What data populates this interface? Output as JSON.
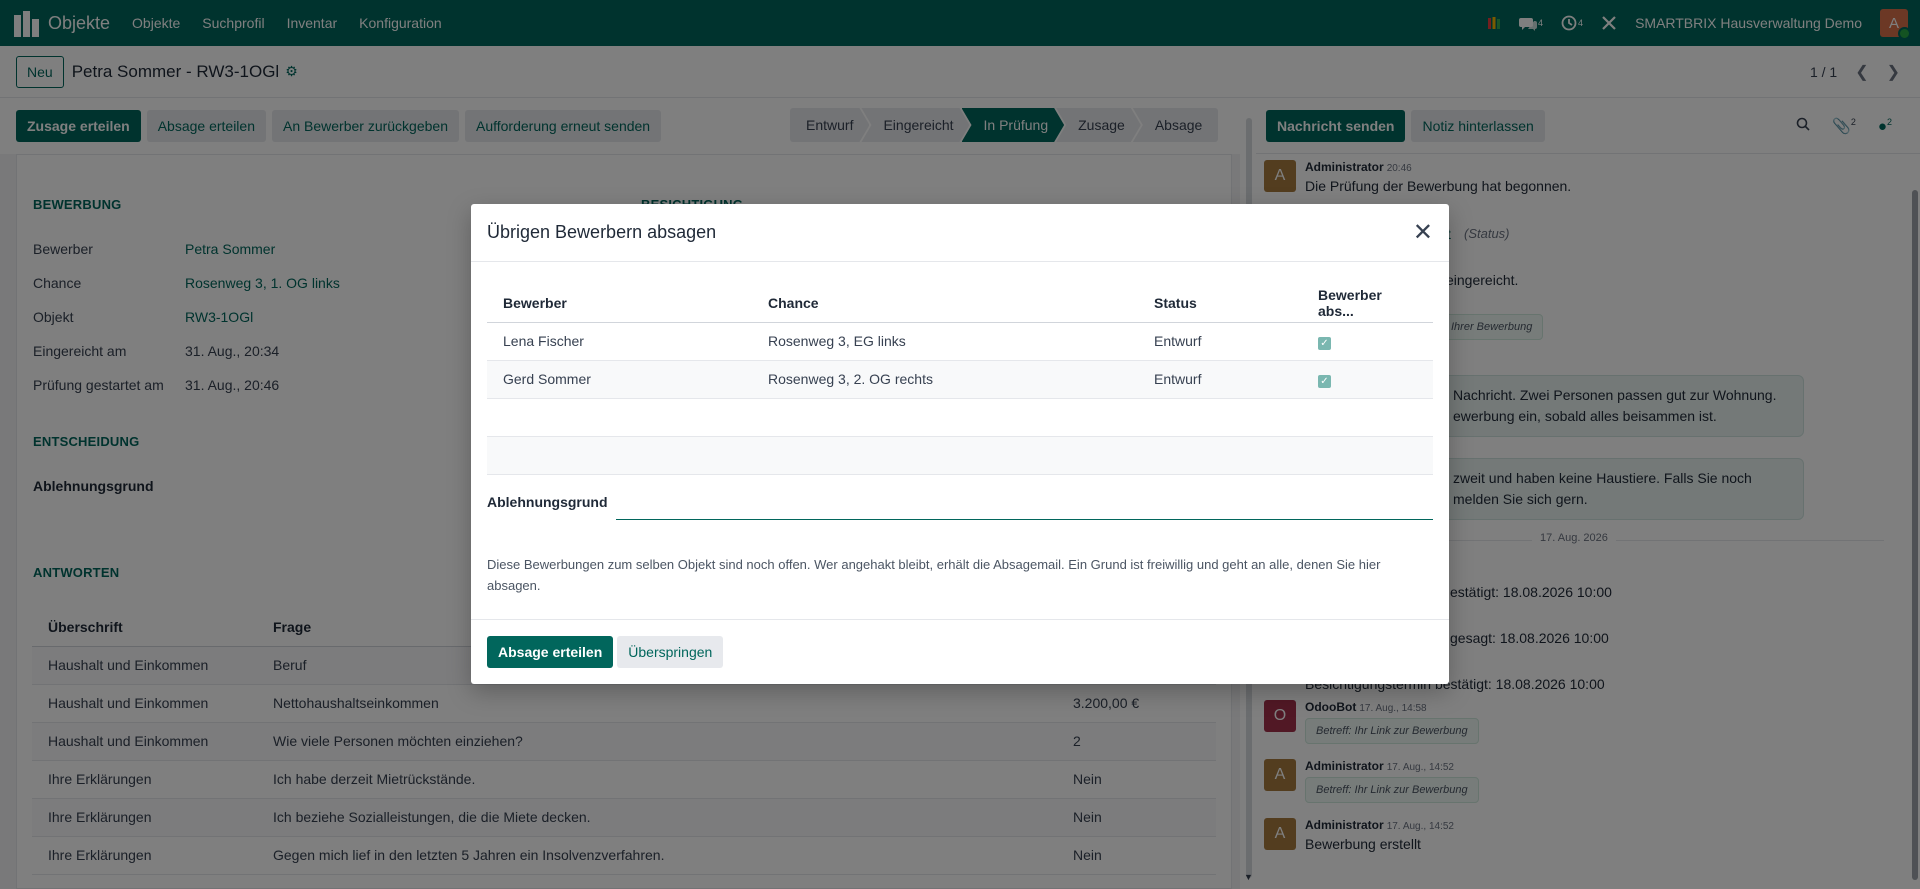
{
  "topbar": {
    "app_title": "Objekte",
    "menu": [
      "Objekte",
      "Suchprofil",
      "Inventar",
      "Konfiguration"
    ],
    "icons": {
      "colors_icon": "colors-icon",
      "chat_icon": "chat-icon",
      "activity_icon": "clock-icon",
      "debug_icon": "tools-icon"
    },
    "chat_count": "4",
    "activity_count": "4",
    "company": "SMARTBRIX Hausverwaltung Demo",
    "avatar_letter": "A"
  },
  "control": {
    "new_label": "Neu",
    "breadcrumb": "Petra Sommer - RW3-1OGl",
    "pager": "1 / 1"
  },
  "status": {
    "buttons": [
      "Zusage erteilen",
      "Absage erteilen",
      "An Bewerber zurückgeben",
      "Aufforderung erneut senden"
    ],
    "stages": [
      "Entwurf",
      "Eingereicht",
      "In Prüfung",
      "Zusage",
      "Absage"
    ]
  },
  "form": {
    "section_bewerbung": "BEWERBUNG",
    "section_besichtigung": "BESICHTIGUNG",
    "fields": [
      {
        "label": "Bewerber",
        "value": "Petra Sommer"
      },
      {
        "label": "Chance",
        "value": "Rosenweg 3, 1. OG links"
      },
      {
        "label": "Objekt",
        "value": "RW3-1OGl"
      },
      {
        "label": "Eingereicht am",
        "value": "31. Aug., 20:34"
      },
      {
        "label": "Prüfung gestartet am",
        "value": "31. Aug., 20:46"
      }
    ],
    "section_entscheidung": "ENTSCHEIDUNG",
    "ablehnungsgrund_label": "Ablehnungsgrund",
    "section_antworten": "ANTWORTEN",
    "answers_headers": [
      "Überschrift",
      "Frage",
      ""
    ],
    "answers": [
      {
        "heading": "Haushalt und Einkommen",
        "question": "Beruf",
        "answer": ""
      },
      {
        "heading": "Haushalt und Einkommen",
        "question": "Nettohaushaltseinkommen",
        "answer": "3.200,00 €"
      },
      {
        "heading": "Haushalt und Einkommen",
        "question": "Wie viele Personen möchten einziehen?",
        "answer": "2"
      },
      {
        "heading": "Ihre Erklärungen",
        "question": "Ich habe derzeit Mietrückstände.",
        "answer": "Nein"
      },
      {
        "heading": "Ihre Erklärungen",
        "question": "Ich beziehe Sozialleistungen, die die Miete decken.",
        "answer": "Nein"
      },
      {
        "heading": "Ihre Erklärungen",
        "question": "Gegen mich lief in den letzten 5 Jahren ein Insolvenzverfahren.",
        "answer": "Nein"
      }
    ]
  },
  "chatter": {
    "send_message": "Nachricht senden",
    "log_note": "Notiz hinterlassen",
    "attachments_count": "2",
    "followers_count": "2",
    "msg1": {
      "author": "Administrator",
      "time": "20:46",
      "body": "Die Prüfung der Bewerbung hat begonnen."
    },
    "status_tail": "t",
    "status_label": "(Status)",
    "eingereicht_tail": "eingereicht.",
    "tag_tail": "Ihrer Bewerbung",
    "bubble1_line1": "Nachricht. Zwei Personen passen gut zur Wohnung.",
    "bubble1_line2": "ewerbung ein, sobald alles beisammen ist.",
    "bubble2_line1": "zweit und haben keine Haustiere. Falls Sie noch",
    "bubble2_line2": "melden Sie sich gern.",
    "date_divider": "17. Aug. 2026",
    "confirm1": "estätigt: 18.08.2026 10:00",
    "confirm2": "gesagt: 18.08.2026 10:00",
    "confirm3": "Besichtigungstermin bestätigt: 18.08.2026 10:00",
    "msg_odoobot": {
      "author": "OdooBot",
      "time": "17. Aug., 14:58",
      "tag": "Betreff: Ihr Link zur Bewerbung",
      "letter": "O"
    },
    "msg_admin1": {
      "author": "Administrator",
      "time": "17. Aug., 14:52",
      "tag": "Betreff: Ihr Link zur Bewerbung",
      "letter": "A"
    },
    "msg_admin2": {
      "author": "Administrator",
      "time": "17. Aug., 14:52",
      "body": "Bewerbung erstellt",
      "letter": "A"
    }
  },
  "modal": {
    "title": "Übrigen Bewerbern absagen",
    "headers": [
      "Bewerber",
      "Chance",
      "Status",
      "Bewerber abs..."
    ],
    "rows": [
      {
        "applicant": "Lena Fischer",
        "chance": "Rosenweg 3, EG links",
        "status": "Entwurf",
        "checked": true
      },
      {
        "applicant": "Gerd Sommer",
        "chance": "Rosenweg 3, 2. OG rechts",
        "status": "Entwurf",
        "checked": true
      }
    ],
    "reason_label": "Ablehnungsgrund",
    "reason_value": "",
    "note": "Diese Bewerbungen zum selben Objekt sind noch offen. Wer angehakt bleibt, erhält die Absagemail. Ein Grund ist freiwillig und geht an alle, denen Sie hier absagen.",
    "confirm_button": "Absage erteilen",
    "skip_button": "Überspringen"
  },
  "colors": {
    "brand": "#01665c",
    "avatar_admin": "#a77b3e",
    "avatar_bot": "#a2304a"
  }
}
